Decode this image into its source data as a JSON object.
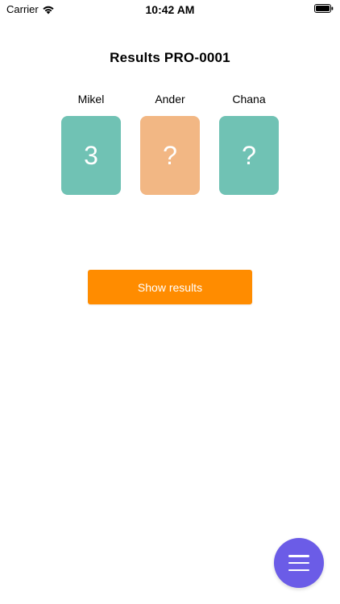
{
  "status_bar": {
    "carrier": "Carrier",
    "time": "10:42 AM",
    "wifi_icon": "wifi-icon",
    "battery_icon": "battery-icon"
  },
  "page": {
    "title": "Results PRO-0001"
  },
  "players": [
    {
      "name": "Mikel",
      "card_value": "3",
      "card_color": "#70c2b4"
    },
    {
      "name": "Ander",
      "card_value": "?",
      "card_color": "#f2b784"
    },
    {
      "name": "Chana",
      "card_value": "?",
      "card_color": "#70c2b4"
    }
  ],
  "actions": {
    "show_results_label": "Show results",
    "show_results_color": "#ff8c00"
  },
  "fab": {
    "icon": "menu-icon",
    "color": "#6b5ce7"
  }
}
